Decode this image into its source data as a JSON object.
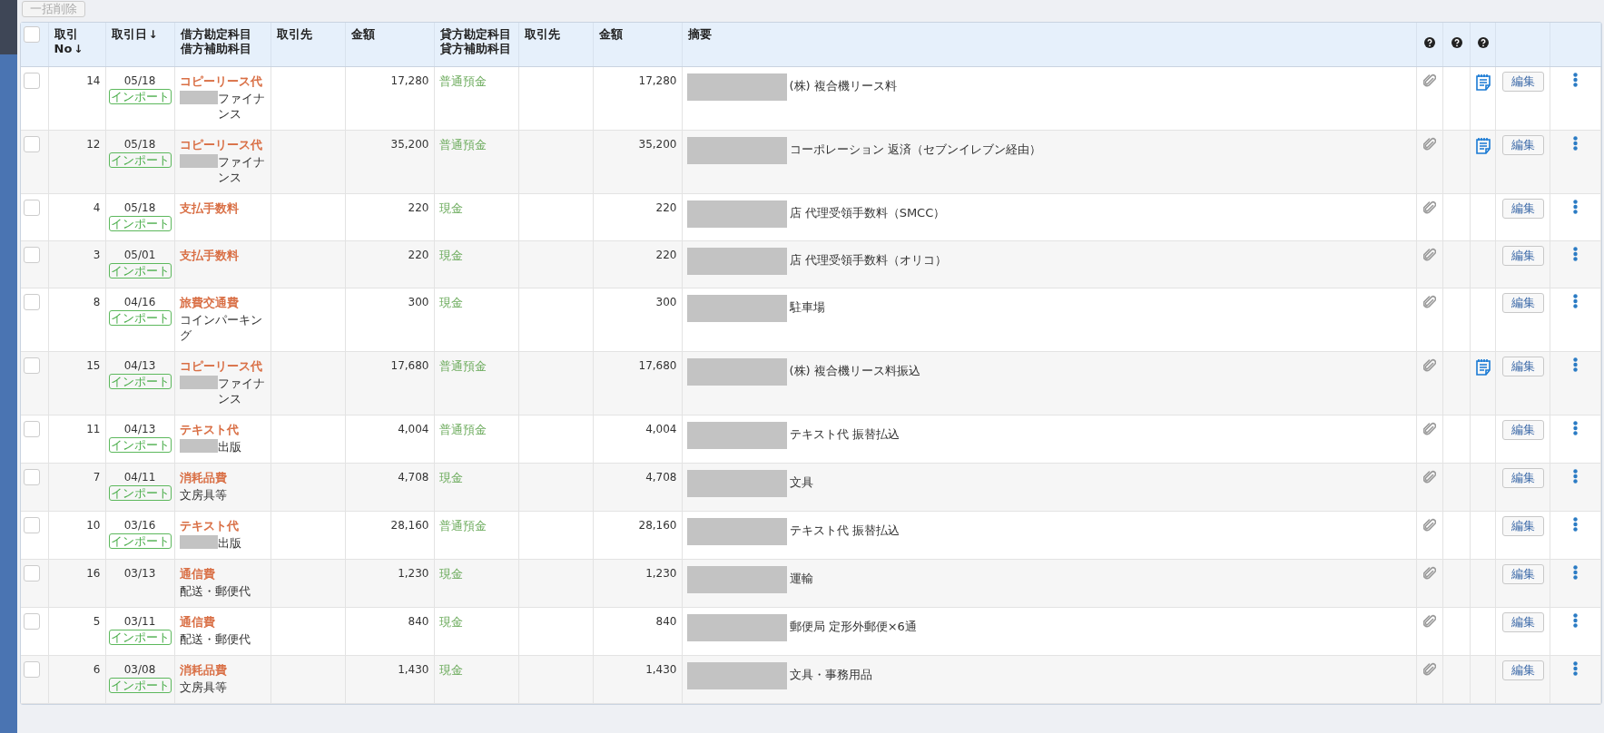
{
  "toolbar": {
    "bulk_delete_button": "一括削除"
  },
  "table": {
    "all_selected": false,
    "columns": [
      {
        "kind": "checkbox"
      },
      {
        "kind": "text",
        "label": "取引No",
        "sort_arrow": "↓"
      },
      {
        "kind": "text",
        "label": "取引日",
        "sort_arrow": "↓"
      },
      {
        "kind": "text",
        "label": "借方勘定科目",
        "sublabel": "借方補助科目"
      },
      {
        "kind": "text",
        "label": "取引先"
      },
      {
        "kind": "text",
        "label": "金額"
      },
      {
        "kind": "text",
        "label": "貸方勘定科目",
        "sublabel": "貸方補助科目"
      },
      {
        "kind": "text",
        "label": "取引先"
      },
      {
        "kind": "text",
        "label": "金額"
      },
      {
        "kind": "text",
        "label": "摘要"
      },
      {
        "kind": "help"
      },
      {
        "kind": "help"
      },
      {
        "kind": "help"
      },
      {
        "kind": "blank"
      },
      {
        "kind": "blank"
      }
    ],
    "rows": [
      {
        "selected": false,
        "no": "14",
        "date": "05/18",
        "badge": "インポート",
        "debit_account": "コピーリース代",
        "debit_sub": "ファイナンス",
        "debit_sub_redacted": true,
        "debit_amount": "17,280",
        "credit_account": "普通預金",
        "credit_amount": "17,280",
        "memo_redacted": true,
        "memo": "(株) 複合機リース料",
        "attachment": true,
        "note": true,
        "edit_button": "編集"
      },
      {
        "selected": false,
        "no": "12",
        "date": "05/18",
        "badge": "インポート",
        "debit_account": "コピーリース代",
        "debit_sub": "ファイナンス",
        "debit_sub_redacted": true,
        "debit_amount": "35,200",
        "credit_account": "普通預金",
        "credit_amount": "35,200",
        "memo_redacted": true,
        "memo": "コーポレーション 返済（セブンイレブン経由）",
        "attachment": true,
        "note": true,
        "edit_button": "編集"
      },
      {
        "selected": false,
        "no": "4",
        "date": "05/18",
        "badge": "インポート",
        "debit_account": "支払手数料",
        "debit_amount": "220",
        "credit_account": "現金",
        "credit_amount": "220",
        "memo_redacted": true,
        "memo": "店 代理受領手数料（SMCC）",
        "attachment": true,
        "note": false,
        "edit_button": "編集"
      },
      {
        "selected": false,
        "no": "3",
        "date": "05/01",
        "badge": "インポート",
        "debit_account": "支払手数料",
        "debit_amount": "220",
        "credit_account": "現金",
        "credit_amount": "220",
        "memo_redacted": true,
        "memo": "店 代理受領手数料（オリコ）",
        "attachment": true,
        "note": false,
        "edit_button": "編集"
      },
      {
        "selected": false,
        "no": "8",
        "date": "04/16",
        "badge": "インポート",
        "debit_account": "旅費交通費",
        "debit_sub": "コインパーキング",
        "debit_amount": "300",
        "credit_account": "現金",
        "credit_amount": "300",
        "memo_redacted": true,
        "memo": "駐車場",
        "attachment": true,
        "note": false,
        "edit_button": "編集"
      },
      {
        "selected": false,
        "no": "15",
        "date": "04/13",
        "badge": "インポート",
        "debit_account": "コピーリース代",
        "debit_sub": "ファイナンス",
        "debit_sub_redacted": true,
        "debit_amount": "17,680",
        "credit_account": "普通預金",
        "credit_amount": "17,680",
        "memo_redacted": true,
        "memo": "(株) 複合機リース料振込",
        "attachment": true,
        "note": true,
        "edit_button": "編集"
      },
      {
        "selected": false,
        "no": "11",
        "date": "04/13",
        "badge": "インポート",
        "debit_account": "テキスト代",
        "debit_sub": "出版",
        "debit_sub_redacted": true,
        "debit_amount": "4,004",
        "credit_account": "普通預金",
        "credit_amount": "4,004",
        "memo_redacted": true,
        "memo": "テキスト代 振替払込",
        "attachment": true,
        "note": false,
        "edit_button": "編集"
      },
      {
        "selected": false,
        "no": "7",
        "date": "04/11",
        "badge": "インポート",
        "debit_account": "消耗品費",
        "debit_sub": "文房具等",
        "debit_amount": "4,708",
        "credit_account": "現金",
        "credit_amount": "4,708",
        "memo_redacted": true,
        "memo": "文具",
        "attachment": true,
        "note": false,
        "edit_button": "編集"
      },
      {
        "selected": false,
        "no": "10",
        "date": "03/16",
        "badge": "インポート",
        "debit_account": "テキスト代",
        "debit_sub": "出版",
        "debit_sub_redacted": true,
        "debit_amount": "28,160",
        "credit_account": "普通預金",
        "credit_amount": "28,160",
        "memo_redacted": true,
        "memo": "テキスト代 振替払込",
        "attachment": true,
        "note": false,
        "edit_button": "編集"
      },
      {
        "selected": false,
        "no": "16",
        "date": "03/13",
        "debit_account": "通信費",
        "debit_sub": "配送・郵便代",
        "debit_amount": "1,230",
        "credit_account": "現金",
        "credit_amount": "1,230",
        "memo_redacted": true,
        "memo": "運輸",
        "attachment": true,
        "note": false,
        "edit_button": "編集"
      },
      {
        "selected": false,
        "no": "5",
        "date": "03/11",
        "badge": "インポート",
        "debit_account": "通信費",
        "debit_sub": "配送・郵便代",
        "debit_amount": "840",
        "credit_account": "現金",
        "credit_amount": "840",
        "memo_redacted": true,
        "memo": "郵便局 定形外郵便×6通",
        "attachment": true,
        "note": false,
        "edit_button": "編集"
      },
      {
        "selected": false,
        "no": "6",
        "date": "03/08",
        "badge": "インポート",
        "debit_account": "消耗品費",
        "debit_sub": "文房具等",
        "debit_amount": "1,430",
        "credit_account": "現金",
        "credit_amount": "1,430",
        "memo_redacted": true,
        "memo": "文具・事務用品",
        "attachment": true,
        "note": false,
        "edit_button": "編集"
      }
    ]
  }
}
